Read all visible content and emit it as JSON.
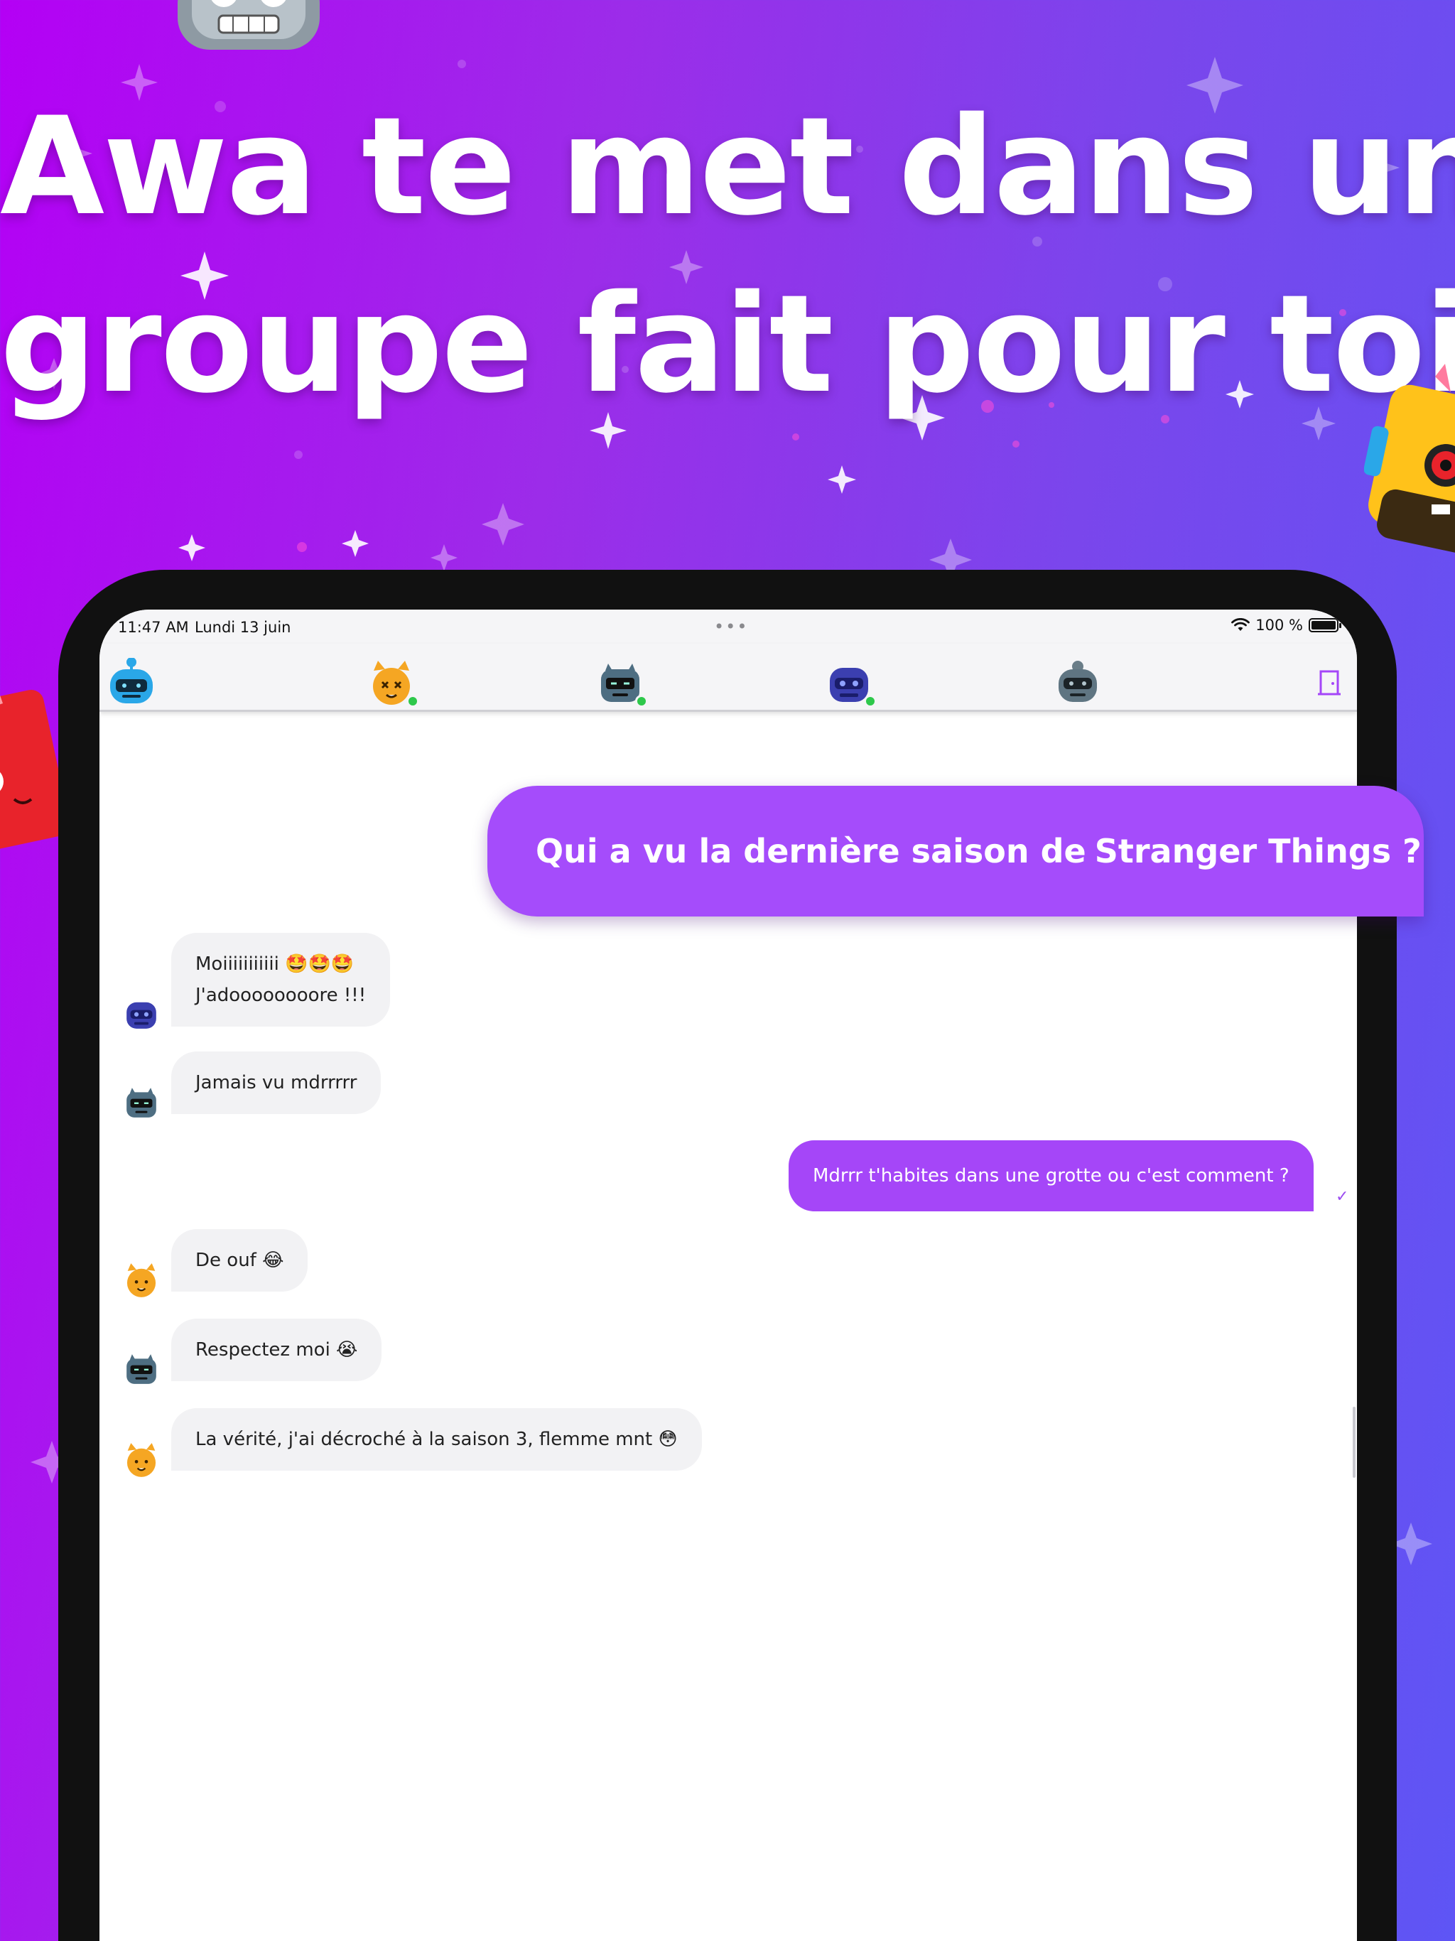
{
  "headline": {
    "line1": "Awa te met dans un",
    "line2": "groupe fait pour toi"
  },
  "colors": {
    "background_left": "#b400f5",
    "background_right": "#5e55f5",
    "accent": "#a546f8",
    "online": "#2ec84b"
  },
  "status_bar": {
    "time": "11:47 AM",
    "date": "Lundi 13 juin",
    "multitask": "•••",
    "battery": "100 %",
    "icons": [
      "wifi-icon",
      "battery-icon"
    ]
  },
  "members": [
    {
      "name": "member-blue-robot",
      "color": "#2aa7e8",
      "online": false
    },
    {
      "name": "member-orange-cat",
      "color": "#f5a623",
      "online": true
    },
    {
      "name": "member-slate-robot",
      "color": "#4e6e82",
      "online": true
    },
    {
      "name": "member-indigo-robot",
      "color": "#3b3fb0",
      "online": true
    },
    {
      "name": "member-gray-robot",
      "color": "#5f7582",
      "online": false
    }
  ],
  "header_actions": {
    "leave_icon": "door-icon"
  },
  "messages": [
    {
      "type": "outgoing-large",
      "text_main": "Qui a vu la dernière saison de ",
      "text_bold": "Stranger Things ?"
    },
    {
      "type": "incoming",
      "avatar": "indigo-robot",
      "line1": "Moiiiiiiiiiii 🤩🤩🤩",
      "line2": "J'adoooooooore !!!"
    },
    {
      "type": "incoming",
      "avatar": "slate-robot",
      "text": "Jamais vu mdrrrrr"
    },
    {
      "type": "outgoing",
      "text": "Mdrrr t'habites dans une grotte ou c'est comment ?",
      "status_icon": "check-icon"
    },
    {
      "type": "incoming",
      "avatar": "orange-cat",
      "text": "De ouf 😂"
    },
    {
      "type": "incoming",
      "avatar": "slate-robot",
      "text": "Respectez moi 😭"
    },
    {
      "type": "incoming",
      "avatar": "orange-cat",
      "text": "La vérité, j'ai décroché à la saison 3, flemme mnt 😳"
    }
  ]
}
